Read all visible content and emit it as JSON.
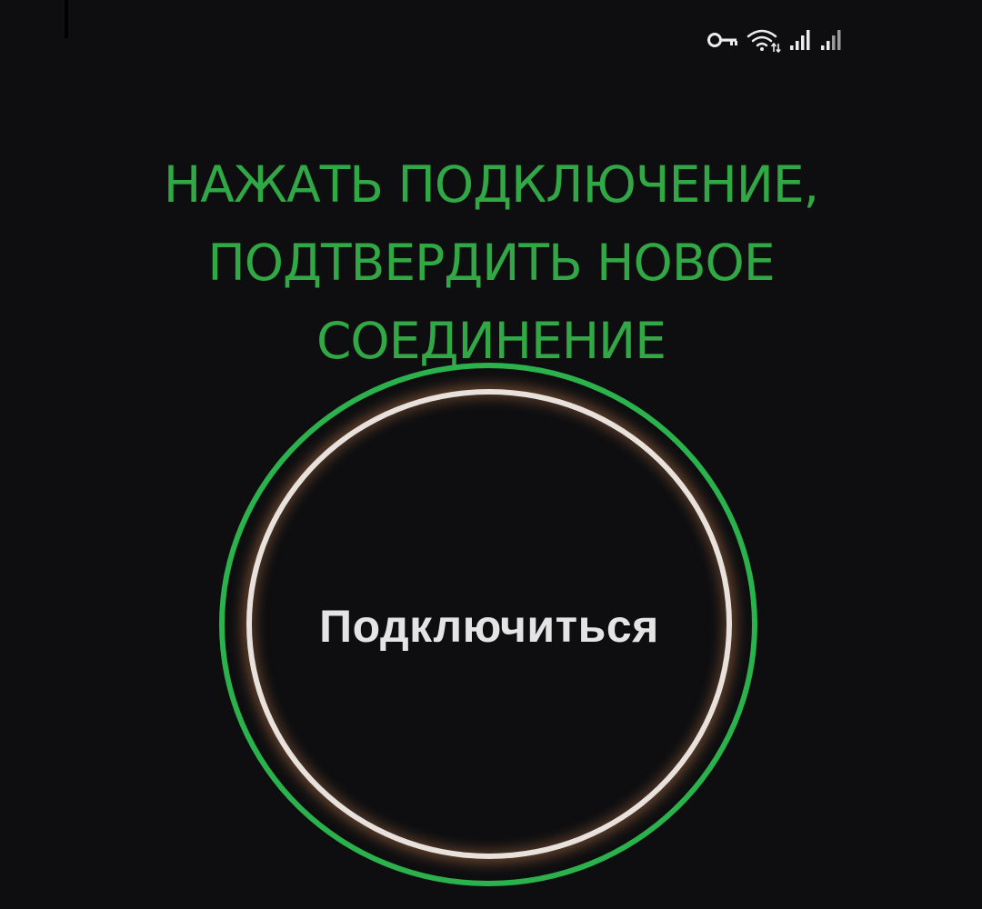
{
  "status_bar": {
    "icons": [
      "vpn-key-icon",
      "wifi-icon",
      "signal-icon",
      "signal-icon-secondary"
    ]
  },
  "instruction": {
    "lines": [
      "НАЖАТЬ ПОДКЛЮЧЕНИЕ,",
      "ПОДТВЕРДИТЬ НОВОЕ",
      "СОЕДИНЕНИЕ"
    ]
  },
  "connect_button": {
    "label": "Подключиться"
  },
  "colors": {
    "background": "#0e0e10",
    "accent_green": "#2bb24c",
    "instruction_text": "#31a845",
    "inner_ring": "#e8e1dc",
    "button_text": "#e4e4e4"
  }
}
